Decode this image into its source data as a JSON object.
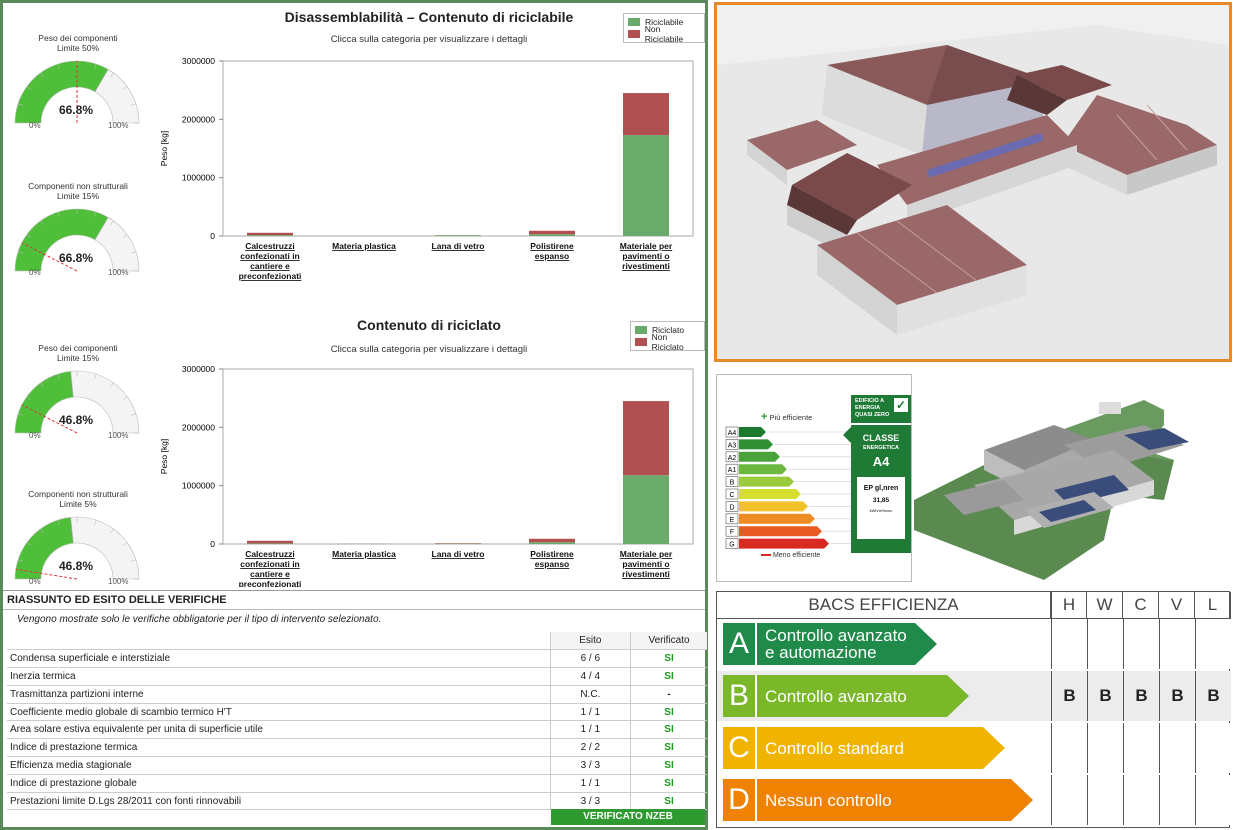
{
  "disassembly": {
    "title": "Disassemblabilità – Contenuto di riciclabile",
    "subtitle": "Clicca sulla categoria per visualizzare i dettagli",
    "legend": [
      "Riciclabile",
      "Non Riciclabile"
    ],
    "ylabel": "Peso [kg]",
    "gauges": [
      {
        "label1": "Peso dei componenti",
        "label2": "Limite 50%",
        "value": "66.8%",
        "fraction": 0.668,
        "min": "0%",
        "max": "100%"
      },
      {
        "label1": "Componenti non strutturali",
        "label2": "Limite 15%",
        "value": "66.8%",
        "fraction": 0.668,
        "min": "0%",
        "max": "100%"
      }
    ]
  },
  "recycled": {
    "title": "Contenuto di riciclato",
    "subtitle": "Clicca sulla categoria per visualizzare i dettagli",
    "legend": [
      "Riciclato",
      "Non Riciclato"
    ],
    "ylabel": "Peso [kg]",
    "gauges": [
      {
        "label1": "Peso dei componenti",
        "label2": "Limite 15%",
        "value": "46.8%",
        "fraction": 0.468,
        "min": "0%",
        "max": "100%"
      },
      {
        "label1": "Componenti non strutturali",
        "label2": "Limite 5%",
        "value": "46.8%",
        "fraction": 0.468,
        "min": "0%",
        "max": "100%"
      }
    ]
  },
  "chart_data": [
    {
      "type": "bar",
      "title": "Disassemblabilità – Contenuto di riciclabile",
      "subtitle": "Clicca sulla categoria per visualizzare i dettagli",
      "ylabel": "Peso [kg]",
      "ylim": [
        0,
        3000000
      ],
      "yticks": [
        "3000000",
        "2000000",
        "1000000",
        "0"
      ],
      "stacked": true,
      "categories": [
        "Calcestruzzi confezionati in cantiere e preconfezionati",
        "Materia plastica",
        "Lana di vetro",
        "Polistirene espanso",
        "Materiale per pavimenti o rivestimenti"
      ],
      "series": [
        {
          "name": "Riciclabile",
          "color": "#6aaa6a",
          "values": [
            15000,
            2000,
            12000,
            30000,
            1730000
          ]
        },
        {
          "name": "Non Riciclabile",
          "color": "#b05050",
          "values": [
            40000,
            1000,
            3000,
            60000,
            720000
          ]
        }
      ],
      "legend": "top-right",
      "grid": false
    },
    {
      "type": "bar",
      "title": "Contenuto di riciclato",
      "subtitle": "Clicca sulla categoria per visualizzare i dettagli",
      "ylabel": "Peso [kg]",
      "ylim": [
        0,
        3000000
      ],
      "yticks": [
        "3000000",
        "2000000",
        "1000000",
        "0"
      ],
      "stacked": true,
      "categories": [
        "Calcestruzzi confezionati in cantiere e preconfezionati",
        "Materia plastica",
        "Lana di vetro",
        "Polistirene espanso",
        "Materiale per pavimenti o rivestimenti"
      ],
      "series": [
        {
          "name": "Riciclato",
          "color": "#6aaa6a",
          "values": [
            10000,
            1000,
            5000,
            30000,
            1180000
          ]
        },
        {
          "name": "Non Riciclato",
          "color": "#b05050",
          "values": [
            45000,
            2000,
            8000,
            60000,
            1270000
          ]
        }
      ],
      "legend": "top-right",
      "grid": false
    }
  ],
  "summary": {
    "title": "RIASSUNTO ED ESITO DELLE VERIFICHE",
    "note": "Vengono mostrate solo le verifiche obbligatorie per il tipo di intervento selezionato.",
    "col_esito": "Esito",
    "col_verificato": "Verificato",
    "rows": [
      {
        "name": "Condensa superficiale e interstiziale",
        "esito": "6 / 6",
        "ok": "SI"
      },
      {
        "name": "Inerzia termica",
        "esito": "4 / 4",
        "ok": "SI"
      },
      {
        "name": "Trasmittanza partizioni interne",
        "esito": "N.C.",
        "ok": "-"
      },
      {
        "name": "Coefficiente medio globale di scambio termico H'T",
        "esito": "1 / 1",
        "ok": "SI"
      },
      {
        "name": "Area solare estiva equivalente per unita di superficie utile",
        "esito": "1 / 1",
        "ok": "SI"
      },
      {
        "name": "Indice di prestazione termica",
        "esito": "2 / 2",
        "ok": "SI"
      },
      {
        "name": "Efficienza media stagionale",
        "esito": "3 / 3",
        "ok": "SI"
      },
      {
        "name": "Indice di prestazione globale",
        "esito": "1 / 1",
        "ok": "SI"
      },
      {
        "name": "Prestazioni limite D.Lgs 28/2011 con fonti rinnovabili",
        "esito": "3 / 3",
        "ok": "SI"
      }
    ],
    "banner": "VERIFICATO NZEB"
  },
  "energy": {
    "more_efficient": "Più efficiente",
    "less_efficient": "Meno efficiente",
    "classes": [
      "A4",
      "A3",
      "A2",
      "A1",
      "B",
      "C",
      "D",
      "E",
      "F",
      "G"
    ],
    "colors": [
      "#1b7a2e",
      "#2f8f32",
      "#4aa33a",
      "#6cb83f",
      "#9acb3c",
      "#d6df2f",
      "#f2c22b",
      "#ee8c24",
      "#e85a22",
      "#d92a22"
    ],
    "nzeb_badge": "EDIFICIO A ENERGIA QUASI ZERO",
    "class_label": "CLASSE",
    "class_sub": "ENERGETICA",
    "class_value": "A4",
    "ep_label": "EP gl,nren",
    "ep_value": "31,85",
    "ep_unit": "kWh/m²anno"
  },
  "bacs": {
    "title": "BACS EFFICIENZA",
    "cols": [
      "H",
      "W",
      "C",
      "V",
      "L"
    ],
    "rows": [
      {
        "letter": "A",
        "label1": "Controllo avanzato",
        "label2": "e automazione",
        "color": "#1f8a4a",
        "values": [
          "",
          "",
          "",
          "",
          ""
        ]
      },
      {
        "letter": "B",
        "label1": "Controllo avanzato",
        "label2": "",
        "color": "#7ab829",
        "values": [
          "B",
          "B",
          "B",
          "B",
          "B"
        ]
      },
      {
        "letter": "C",
        "label1": "Controllo standard",
        "label2": "",
        "color": "#f0b400",
        "values": [
          "",
          "",
          "",
          "",
          ""
        ]
      },
      {
        "letter": "D",
        "label1": "Nessun controllo",
        "label2": "",
        "color": "#ef8200",
        "values": [
          "",
          "",
          "",
          "",
          ""
        ]
      }
    ]
  }
}
